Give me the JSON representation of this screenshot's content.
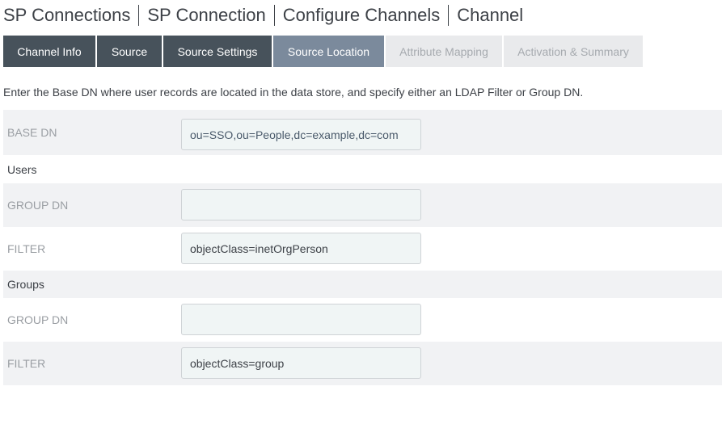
{
  "breadcrumb": [
    "SP Connections",
    "SP Connection",
    "Configure Channels",
    "Channel"
  ],
  "tabs": [
    {
      "label": "Channel Info",
      "state": "done"
    },
    {
      "label": "Source",
      "state": "done"
    },
    {
      "label": "Source Settings",
      "state": "done"
    },
    {
      "label": "Source Location",
      "state": "active"
    },
    {
      "label": "Attribute Mapping",
      "state": "todo"
    },
    {
      "label": "Activation & Summary",
      "state": "todo"
    }
  ],
  "description": "Enter the Base DN where user records are located in the data store, and specify either an LDAP Filter or Group DN.",
  "form": {
    "base_dn": {
      "label": "BASE DN",
      "value": "ou=SSO,ou=People,dc=example,dc=com"
    },
    "users": {
      "section_label": "Users",
      "group_dn": {
        "label": "GROUP DN",
        "value": ""
      },
      "filter": {
        "label": "FILTER",
        "value": "objectClass=inetOrgPerson"
      }
    },
    "groups": {
      "section_label": "Groups",
      "group_dn": {
        "label": "GROUP DN",
        "value": ""
      },
      "filter": {
        "label": "FILTER",
        "value": "objectClass=group"
      }
    }
  },
  "colors": {
    "tab_done": "#47525b",
    "tab_active": "#7b8a9c",
    "tab_todo": "#e9eaec",
    "row_alt": "#f1f2f4",
    "input_bg": "#f0f5f5"
  }
}
